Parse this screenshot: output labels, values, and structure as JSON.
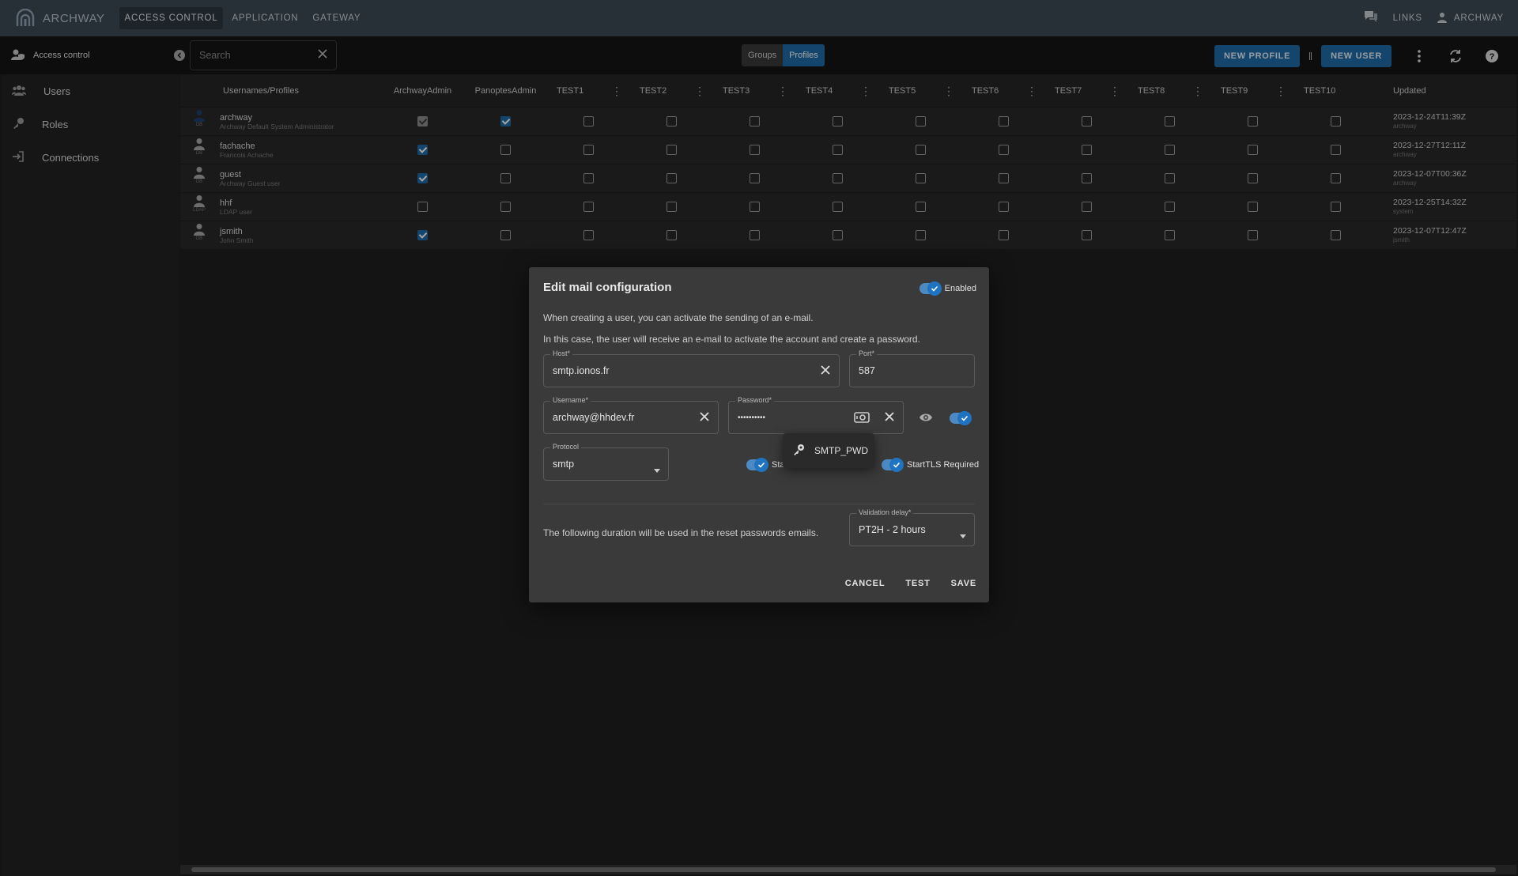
{
  "topbar": {
    "logo_text": "ARCHWAY",
    "nav": [
      "ACCESS CONTROL",
      "APPLICATION",
      "GATEWAY"
    ],
    "links_label": "LINKS",
    "user_label": "ARCHWAY"
  },
  "subbar": {
    "section_title": "Access control",
    "search_placeholder": "Search",
    "toggle": [
      "Groups",
      "Profiles"
    ],
    "new_profile": "NEW PROFILE",
    "new_user": "NEW USER"
  },
  "sidebar": {
    "items": [
      {
        "label": "Users",
        "icon": "users-icon"
      },
      {
        "label": "Roles",
        "icon": "key-icon"
      },
      {
        "label": "Connections",
        "icon": "login-icon"
      }
    ]
  },
  "table": {
    "headers": {
      "user": "Usernames/Profiles",
      "profiles": [
        "ArchwayAdmin",
        "PanoptesAdmin",
        "TEST1",
        "TEST2",
        "TEST3",
        "TEST4",
        "TEST5",
        "TEST6",
        "TEST7",
        "TEST8",
        "TEST9",
        "TEST10"
      ],
      "updated": "Updated"
    },
    "rows": [
      {
        "name": "archway",
        "desc": "Archway Default System Administrator",
        "source": "DB",
        "checks": [
          "grey",
          "on",
          0,
          0,
          0,
          0,
          0,
          0,
          0,
          0,
          0,
          0
        ],
        "updated": "2023-12-24T11:39Z",
        "updated_by": "archway"
      },
      {
        "name": "fachache",
        "desc": "Francois Achache",
        "source": "DB",
        "checks": [
          "on",
          0,
          0,
          0,
          0,
          0,
          0,
          0,
          0,
          0,
          0,
          0
        ],
        "updated": "2023-12-27T12:11Z",
        "updated_by": "archway"
      },
      {
        "name": "guest",
        "desc": "Archway Guest user",
        "source": "DB",
        "checks": [
          "on",
          0,
          0,
          0,
          0,
          0,
          0,
          0,
          0,
          0,
          0,
          0
        ],
        "updated": "2023-12-07T00:36Z",
        "updated_by": "archway"
      },
      {
        "name": "hhf",
        "desc": "LDAP user",
        "source": "LDAP",
        "checks": [
          0,
          0,
          0,
          0,
          0,
          0,
          0,
          0,
          0,
          0,
          0,
          0
        ],
        "updated": "2023-12-25T14:32Z",
        "updated_by": "system"
      },
      {
        "name": "jsmith",
        "desc": "John Smith",
        "source": "DB",
        "checks": [
          "on",
          0,
          0,
          0,
          0,
          0,
          0,
          0,
          0,
          0,
          0,
          0
        ],
        "updated": "2023-12-07T12:47Z",
        "updated_by": "jsmith"
      }
    ]
  },
  "modal": {
    "title": "Edit mail configuration",
    "enabled_label": "Enabled",
    "para1": "When creating a user, you can activate the sending of an e-mail.",
    "para2": "In this case, the user will receive an e-mail to activate the account and create a password.",
    "host_label": "Host*",
    "host_value": "smtp.ionos.fr",
    "port_label": "Port*",
    "port_value": "587",
    "username_label": "Username*",
    "username_value": "archway@hhdev.fr",
    "password_label": "Password*",
    "password_value": "••••••••••",
    "protocol_label": "Protocol",
    "protocol_value": "smtp",
    "starttls_partial": "Sta",
    "starttls_required": "StartTLS Required",
    "duration_text": "The following duration will be used in the reset passwords emails.",
    "validation_label": "Validation delay*",
    "validation_value": "PT2H - 2 hours",
    "cancel": "CANCEL",
    "test": "TEST",
    "save": "SAVE",
    "popup_label": "SMTP_PWD"
  },
  "colors": {
    "accent": "#1f6aa8",
    "topbar": "#3c4a55"
  }
}
